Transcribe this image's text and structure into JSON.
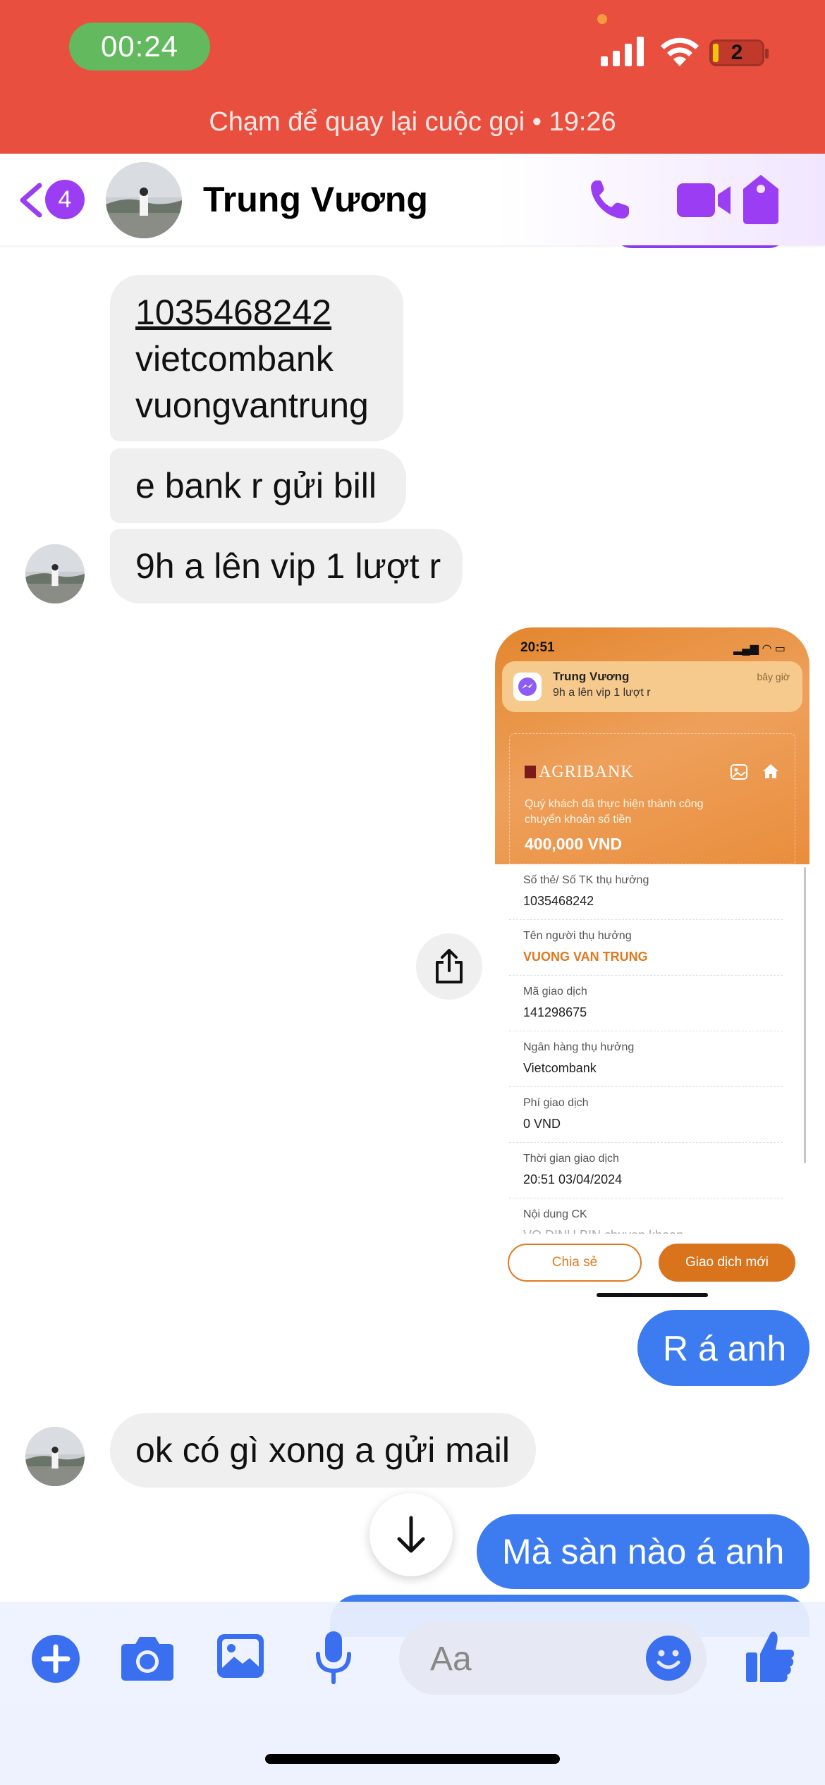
{
  "status_bar": {
    "call_timer": "00:24",
    "battery_level": "2",
    "banner_text": "Chạm để quay lại cuộc gọi • 19:26"
  },
  "header": {
    "back_badge_count": "4",
    "contact_name": "Trung Vương",
    "icons": [
      "back-chevron-icon",
      "phone-icon",
      "video-camera-icon",
      "tag-icon"
    ]
  },
  "messages": [
    {
      "side": "in",
      "lines": [
        "1035468242",
        "vietcombank",
        "vuongvantrung"
      ]
    },
    {
      "side": "in",
      "text": "e bank r gửi bill"
    },
    {
      "side": "in",
      "text": "9h a lên vip 1 lượt r"
    },
    {
      "side": "out",
      "type": "image"
    },
    {
      "side": "out",
      "text": "R á anh"
    },
    {
      "side": "in",
      "text": "ok có gì xong a gửi mail"
    },
    {
      "side": "out",
      "text": "Mà sàn nào á anh"
    }
  ],
  "screenshot": {
    "status_time": "20:51",
    "notification": {
      "sender": "Trung Vương",
      "message": "9h a lên vip 1 lượt r",
      "time": "bây giờ"
    },
    "bank_name": "AGRIBANK",
    "success_text": "Quý khách đã thực hiện thành công chuyển khoản số tiền",
    "amount": "400,000 VND",
    "details": [
      {
        "label": "Số thẻ/ Số TK thụ hưởng",
        "value": "1035468242"
      },
      {
        "label": "Tên người thụ hưởng",
        "value": "VUONG VAN TRUNG"
      },
      {
        "label": "Mã giao dịch",
        "value": "141298675"
      },
      {
        "label": "Ngân hàng thụ hưởng",
        "value": "Vietcombank"
      },
      {
        "label": "Phí giao dịch",
        "value": "0 VND"
      },
      {
        "label": "Thời gian giao dịch",
        "value": "20:51 03/04/2024"
      },
      {
        "label": "Nội dung CK",
        "value": "VO DINH BIN chuyen khoan"
      }
    ],
    "buttons": {
      "share": "Chia sẻ",
      "new_transaction": "Giao dịch mới"
    }
  },
  "composer": {
    "placeholder": "Aa",
    "icons": [
      "plus-icon",
      "camera-icon",
      "gallery-icon",
      "microphone-icon",
      "emoji-icon",
      "thumbs-up-icon"
    ]
  },
  "colors": {
    "call_banner": "#e94f3f",
    "timer_pill": "#62b95e",
    "messenger_purple": "#9b3df2",
    "outgoing_bubble": "#3c7cf0",
    "incoming_bubble": "#efefef",
    "composer_blue": "#3a6ff0",
    "agribank_orange": "#e3862e"
  }
}
